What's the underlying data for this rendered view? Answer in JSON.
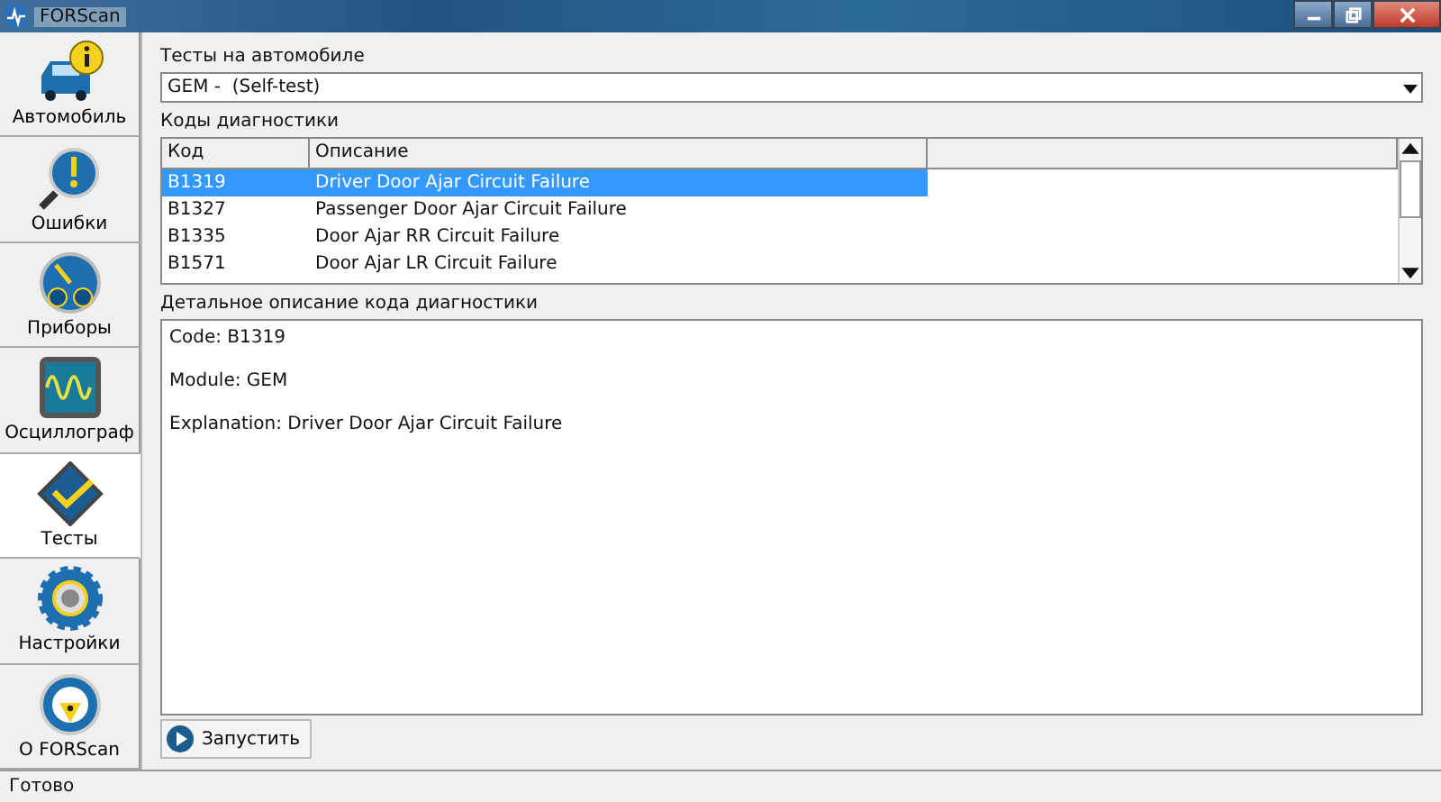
{
  "window": {
    "title": "FORScan"
  },
  "sidebar": {
    "items": [
      {
        "kind": "car",
        "label": "Автомобиль",
        "selected": false
      },
      {
        "kind": "errors",
        "label": "Ошибки",
        "selected": false
      },
      {
        "kind": "gauges",
        "label": "Приборы",
        "selected": false
      },
      {
        "kind": "scope",
        "label": "Осциллограф",
        "selected": false
      },
      {
        "kind": "tests",
        "label": "Тесты",
        "selected": true
      },
      {
        "kind": "settings",
        "label": "Настройки",
        "selected": false
      },
      {
        "kind": "about",
        "label": "О FORScan",
        "selected": false
      }
    ]
  },
  "tests": {
    "label": "Тесты на автомобиле",
    "value": "GEM -  (Self-test)"
  },
  "codes": {
    "label": "Коды диагностики",
    "columns": [
      "Код",
      "Описание"
    ],
    "rows": [
      {
        "code": "B1319",
        "description": "Driver Door Ajar Circuit Failure",
        "selected": true
      },
      {
        "code": "B1327",
        "description": "Passenger Door Ajar Circuit Failure",
        "selected": false
      },
      {
        "code": "B1335",
        "description": "Door Ajar RR Circuit Failure",
        "selected": false
      },
      {
        "code": "B1571",
        "description": "Door Ajar LR Circuit Failure",
        "selected": false
      }
    ]
  },
  "details": {
    "label": "Детальное описание кода диагностики",
    "lines": [
      "Code: B1319",
      "Module: GEM",
      "Explanation: Driver Door Ajar Circuit Failure"
    ]
  },
  "run_button": "Запустить",
  "status_bar": "Готово"
}
